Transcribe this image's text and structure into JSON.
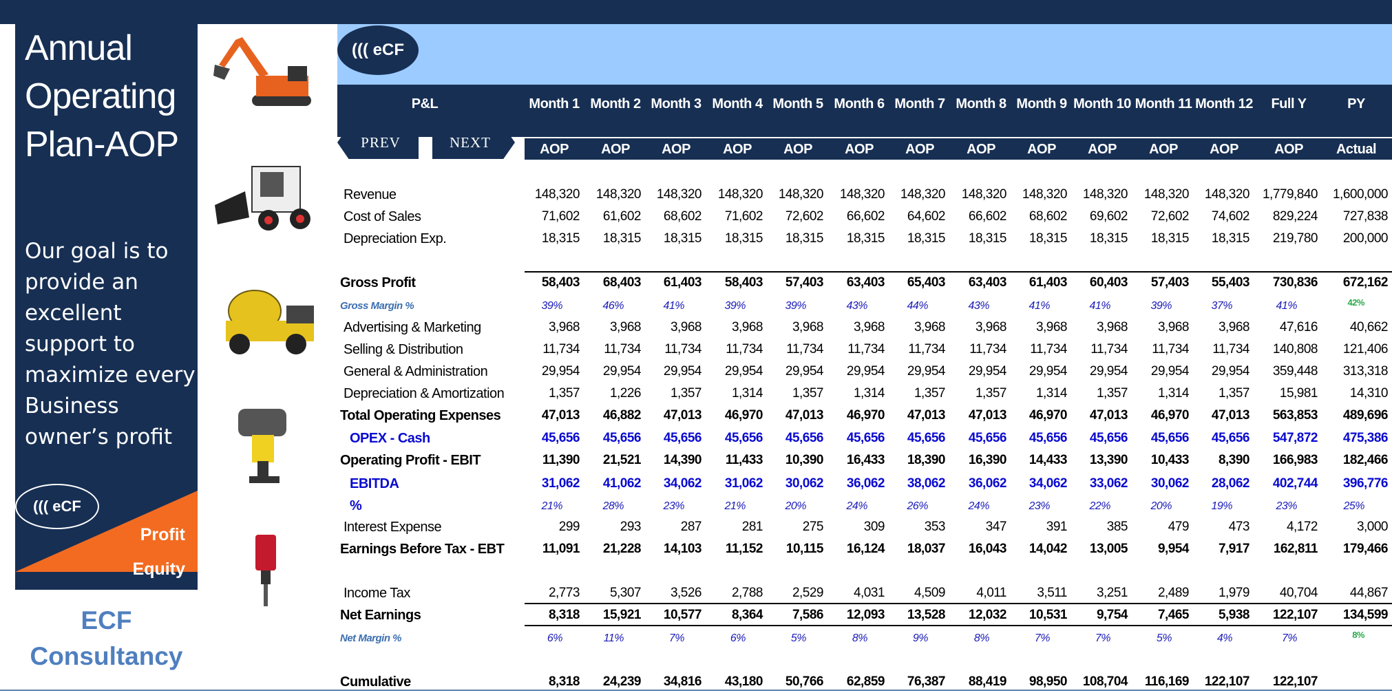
{
  "left_panel": {
    "title": "Annual Operating Plan-AOP",
    "goal": "Our goal is to provide an excellent support to maximize every Business owner’s profit",
    "logo_text": "((( eCF",
    "profit_label": "Profit",
    "equity_label": "Equity",
    "company_line1": "ECF",
    "company_line2": "Consultancy"
  },
  "icons": [
    "excavator-icon",
    "skid-steer-loader-icon",
    "concrete-mixer-truck-icon",
    "tamping-rammer-icon",
    "hydraulic-breaker-icon"
  ],
  "band_logo_text": "((( eCF",
  "nav": {
    "prev": "PREV",
    "next": "NEXT"
  },
  "table": {
    "pl_header": "P&L",
    "columns": [
      "Month 1",
      "Month 2",
      "Month 3",
      "Month 4",
      "Month 5",
      "Month 6",
      "Month 7",
      "Month 8",
      "Month 9",
      "Month 10",
      "Month 11",
      "Month 12",
      "Full Y",
      "PY"
    ],
    "subheaders": [
      "AOP",
      "AOP",
      "AOP",
      "AOP",
      "AOP",
      "AOP",
      "AOP",
      "AOP",
      "AOP",
      "AOP",
      "AOP",
      "AOP",
      "AOP",
      "Actual"
    ],
    "rows": [
      {
        "label": "Revenue",
        "values": [
          "148,320",
          "148,320",
          "148,320",
          "148,320",
          "148,320",
          "148,320",
          "148,320",
          "148,320",
          "148,320",
          "148,320",
          "148,320",
          "148,320",
          "1,779,840",
          "1,600,000"
        ]
      },
      {
        "label": "Cost of Sales",
        "values": [
          "71,602",
          "61,602",
          "68,602",
          "71,602",
          "72,602",
          "66,602",
          "64,602",
          "66,602",
          "68,602",
          "69,602",
          "72,602",
          "74,602",
          "829,224",
          "727,838"
        ]
      },
      {
        "label": "Depreciation Exp.",
        "values": [
          "18,315",
          "18,315",
          "18,315",
          "18,315",
          "18,315",
          "18,315",
          "18,315",
          "18,315",
          "18,315",
          "18,315",
          "18,315",
          "18,315",
          "219,780",
          "200,000"
        ]
      },
      {
        "label": "Gross Profit",
        "values": [
          "58,403",
          "68,403",
          "61,403",
          "58,403",
          "57,403",
          "63,403",
          "65,403",
          "63,403",
          "61,403",
          "60,403",
          "57,403",
          "55,403",
          "730,836",
          "672,162"
        ]
      },
      {
        "label": "Gross Margin %",
        "values": [
          "39%",
          "46%",
          "41%",
          "39%",
          "39%",
          "43%",
          "44%",
          "43%",
          "41%",
          "41%",
          "39%",
          "37%",
          "41%",
          "42%"
        ]
      },
      {
        "label": "Advertising & Marketing",
        "values": [
          "3,968",
          "3,968",
          "3,968",
          "3,968",
          "3,968",
          "3,968",
          "3,968",
          "3,968",
          "3,968",
          "3,968",
          "3,968",
          "3,968",
          "47,616",
          "40,662"
        ]
      },
      {
        "label": "Selling & Distribution",
        "values": [
          "11,734",
          "11,734",
          "11,734",
          "11,734",
          "11,734",
          "11,734",
          "11,734",
          "11,734",
          "11,734",
          "11,734",
          "11,734",
          "11,734",
          "140,808",
          "121,406"
        ]
      },
      {
        "label": "General & Administration",
        "values": [
          "29,954",
          "29,954",
          "29,954",
          "29,954",
          "29,954",
          "29,954",
          "29,954",
          "29,954",
          "29,954",
          "29,954",
          "29,954",
          "29,954",
          "359,448",
          "313,318"
        ]
      },
      {
        "label": "Depreciation & Amortization",
        "values": [
          "1,357",
          "1,226",
          "1,357",
          "1,314",
          "1,357",
          "1,314",
          "1,357",
          "1,357",
          "1,314",
          "1,357",
          "1,314",
          "1,357",
          "15,981",
          "14,310"
        ]
      },
      {
        "label": "Total Operating Expenses",
        "values": [
          "47,013",
          "46,882",
          "47,013",
          "46,970",
          "47,013",
          "46,970",
          "47,013",
          "47,013",
          "46,970",
          "47,013",
          "46,970",
          "47,013",
          "563,853",
          "489,696"
        ]
      },
      {
        "label": "OPEX - Cash",
        "values": [
          "45,656",
          "45,656",
          "45,656",
          "45,656",
          "45,656",
          "45,656",
          "45,656",
          "45,656",
          "45,656",
          "45,656",
          "45,656",
          "45,656",
          "547,872",
          "475,386"
        ]
      },
      {
        "label": "Operating Profit - EBIT",
        "values": [
          "11,390",
          "21,521",
          "14,390",
          "11,433",
          "10,390",
          "16,433",
          "18,390",
          "16,390",
          "14,433",
          "13,390",
          "10,433",
          "8,390",
          "166,983",
          "182,466"
        ]
      },
      {
        "label": "EBITDA",
        "values": [
          "31,062",
          "41,062",
          "34,062",
          "31,062",
          "30,062",
          "36,062",
          "38,062",
          "36,062",
          "34,062",
          "33,062",
          "30,062",
          "28,062",
          "402,744",
          "396,776"
        ]
      },
      {
        "label": "%",
        "values": [
          "21%",
          "28%",
          "23%",
          "21%",
          "20%",
          "24%",
          "26%",
          "24%",
          "23%",
          "22%",
          "20%",
          "19%",
          "23%",
          "25%"
        ]
      },
      {
        "label": "Interest Expense",
        "values": [
          "299",
          "293",
          "287",
          "281",
          "275",
          "309",
          "353",
          "347",
          "391",
          "385",
          "479",
          "473",
          "4,172",
          "3,000"
        ]
      },
      {
        "label": "Earnings Before Tax - EBT",
        "values": [
          "11,091",
          "21,228",
          "14,103",
          "11,152",
          "10,115",
          "16,124",
          "18,037",
          "16,043",
          "14,042",
          "13,005",
          "9,954",
          "7,917",
          "162,811",
          "179,466"
        ]
      },
      {
        "label": "Income Tax",
        "values": [
          "2,773",
          "5,307",
          "3,526",
          "2,788",
          "2,529",
          "4,031",
          "4,509",
          "4,011",
          "3,511",
          "3,251",
          "2,489",
          "1,979",
          "40,704",
          "44,867"
        ]
      },
      {
        "label": "Net Earnings",
        "values": [
          "8,318",
          "15,921",
          "10,577",
          "8,364",
          "7,586",
          "12,093",
          "13,528",
          "12,032",
          "10,531",
          "9,754",
          "7,465",
          "5,938",
          "122,107",
          "134,599"
        ]
      },
      {
        "label": "Net Margin %",
        "values": [
          "6%",
          "11%",
          "7%",
          "6%",
          "5%",
          "8%",
          "9%",
          "8%",
          "7%",
          "7%",
          "5%",
          "4%",
          "7%",
          "8%"
        ]
      },
      {
        "label": "Cumulative",
        "values": [
          "8,318",
          "24,239",
          "34,816",
          "43,180",
          "50,766",
          "62,859",
          "76,387",
          "88,419",
          "98,950",
          "108,704",
          "116,169",
          "122,107",
          "122,107",
          ""
        ]
      }
    ]
  }
}
